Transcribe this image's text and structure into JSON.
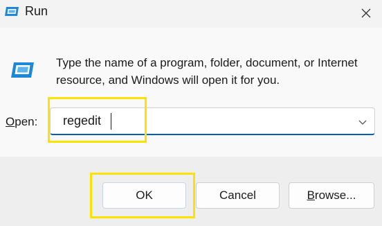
{
  "window": {
    "title": "Run",
    "icon": "run-icon",
    "close_icon": "close-icon"
  },
  "dialog": {
    "description": "Type the name of a program, folder, document, or Internet resource, and Windows will open it for you.",
    "open_label_underlined": "O",
    "open_label_rest": "pen:",
    "open_value": "regedit",
    "dropdown_icon": "chevron-down-icon"
  },
  "buttons": {
    "ok": "OK",
    "cancel": "Cancel",
    "browse_underlined": "B",
    "browse_rest": "rowse..."
  },
  "colors": {
    "highlight": "#ffe100",
    "accent": "#005fb8",
    "icon_blue": "#1e88d6"
  }
}
